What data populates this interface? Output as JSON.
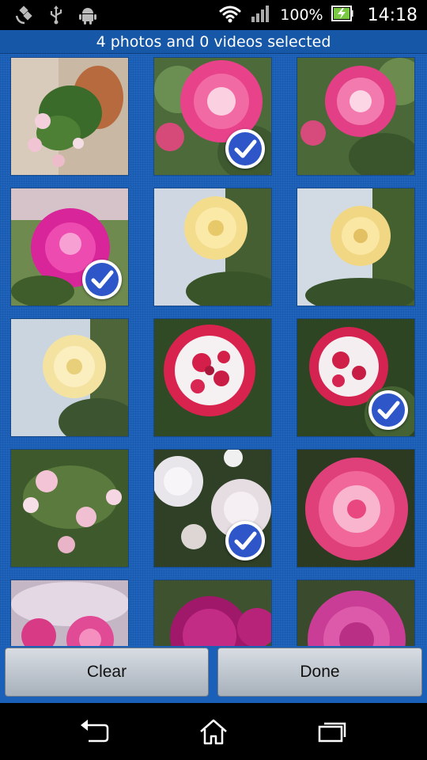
{
  "status_bar": {
    "icons_left": [
      "satellite-icon",
      "usb-icon",
      "android-debug-icon"
    ],
    "battery_percent": "100%",
    "time": "14:18"
  },
  "header": {
    "title": "4 photos and 0 videos selected"
  },
  "photos": [
    {
      "subject": "potted-flower",
      "selected": false
    },
    {
      "subject": "pink-rose",
      "selected": true
    },
    {
      "subject": "pink-rose",
      "selected": false
    },
    {
      "subject": "magenta-rose",
      "selected": true
    },
    {
      "subject": "yellow-rose",
      "selected": false
    },
    {
      "subject": "yellow-rose",
      "selected": false
    },
    {
      "subject": "yellow-rose",
      "selected": false
    },
    {
      "subject": "red-white-rose",
      "selected": false
    },
    {
      "subject": "red-white-rose",
      "selected": true
    },
    {
      "subject": "white-pink-flowers",
      "selected": false
    },
    {
      "subject": "white-roses",
      "selected": true
    },
    {
      "subject": "pink-rose",
      "selected": false
    },
    {
      "subject": "pink-flowers",
      "selected": false
    },
    {
      "subject": "magenta-rose",
      "selected": false
    },
    {
      "subject": "magenta-rose",
      "selected": false
    }
  ],
  "buttons": {
    "clear": "Clear",
    "done": "Done"
  },
  "colors": {
    "accent_blue": "#1a5fb8",
    "check_blue": "#2f56c9"
  }
}
